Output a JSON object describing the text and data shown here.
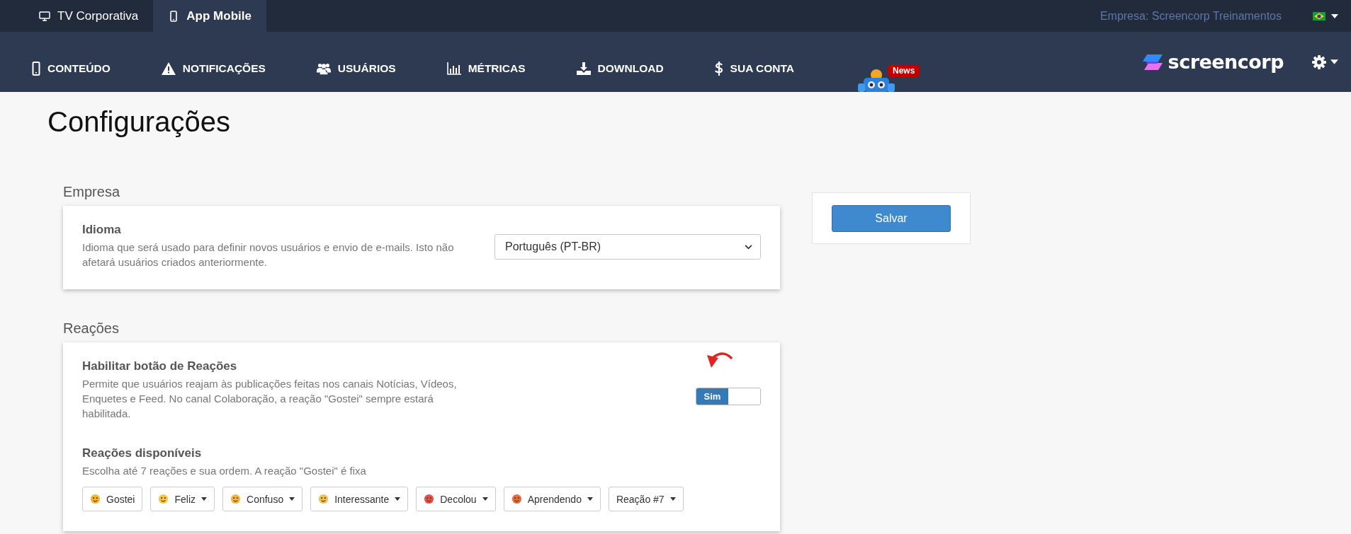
{
  "top_tabs": [
    {
      "label": "TV Corporativa",
      "selected": false
    },
    {
      "label": "App Mobile",
      "selected": true
    }
  ],
  "company": "Empresa: Screencorp Treinamentos",
  "nav": [
    {
      "label": "CONTEÚDO"
    },
    {
      "label": "NOTIFICAÇÕES"
    },
    {
      "label": "USUÁRIOS"
    },
    {
      "label": "MÉTRICAS"
    },
    {
      "label": "DOWNLOAD"
    },
    {
      "label": "SUA CONTA"
    }
  ],
  "news_badge": "News",
  "logo": "screencorp",
  "page_title": "Configurações",
  "sections": [
    {
      "title": "Empresa",
      "settings": [
        {
          "kind": "select",
          "label": "Idioma",
          "description": "Idioma que será usado para definir novos usuários e envio de e-mails. Isto não afetará usuários criados anteriormente.",
          "value": "Português (PT-BR)"
        }
      ]
    },
    {
      "title": "Reações",
      "settings": [
        {
          "kind": "toggle",
          "label": "Habilitar botão de Reações",
          "description": "Permite que usuários reajam às publicações feitas nos canais Notícias, Vídeos, Enquetes e Feed. No canal Colaboração, a reação \"Gostei\" sempre estará habilitada.",
          "on": true,
          "on_label": "Sim"
        },
        {
          "kind": "reactions",
          "label": "Reações disponíveis",
          "description": "Escolha até 7 reações e sua ordem. A reação \"Gostei\" é fixa",
          "reactions": [
            {
              "label": "Gostei",
              "fixed": true
            },
            {
              "label": "Feliz",
              "fixed": false
            },
            {
              "label": "Confuso",
              "fixed": false
            },
            {
              "label": "Interessante",
              "fixed": false
            },
            {
              "label": "Decolou",
              "fixed": false
            },
            {
              "label": "Aprendendo",
              "fixed": false
            },
            {
              "label": "Reação #7",
              "fixed": false
            }
          ]
        }
      ]
    }
  ],
  "save_button": "Salvar"
}
